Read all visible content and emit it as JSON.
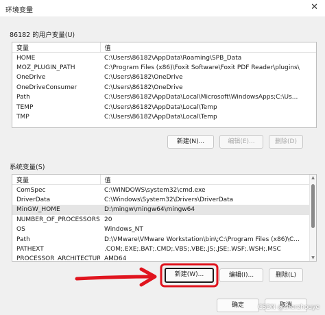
{
  "window": {
    "title": "环境变量",
    "close_icon": "close-icon"
  },
  "user_section": {
    "label": "86182 的用户变量(U)",
    "headers": [
      "变量",
      "值"
    ],
    "rows": [
      [
        "HOME",
        "C:\\Users\\86182\\AppData\\Roaming\\SPB_Data"
      ],
      [
        "MOZ_PLUGIN_PATH",
        "C:\\Program Files (x86)\\Foxit Software\\Foxit PDF Reader\\plugins\\"
      ],
      [
        "OneDrive",
        "C:\\Users\\86182\\OneDrive"
      ],
      [
        "OneDriveConsumer",
        "C:\\Users\\86182\\OneDrive"
      ],
      [
        "Path",
        "C:\\Users\\86182\\AppData\\Local\\Microsoft\\WindowsApps;C:\\Us..."
      ],
      [
        "TEMP",
        "C:\\Users\\86182\\AppData\\Local\\Temp"
      ],
      [
        "TMP",
        "C:\\Users\\86182\\AppData\\Local\\Temp"
      ]
    ],
    "buttons": {
      "new": "新建(N)...",
      "edit": "编辑(E)...",
      "delete": "删除(D)"
    }
  },
  "system_section": {
    "label": "系统变量(S)",
    "headers": [
      "变量",
      "值"
    ],
    "rows": [
      [
        "ComSpec",
        "C:\\WINDOWS\\system32\\cmd.exe"
      ],
      [
        "DriverData",
        "C:\\Windows\\System32\\Drivers\\DriverData"
      ],
      [
        "MinGW_HOME",
        "D:\\mingw\\mingw64\\mingw64"
      ],
      [
        "NUMBER_OF_PROCESSORS",
        "20"
      ],
      [
        "OS",
        "Windows_NT"
      ],
      [
        "Path",
        "D:\\VMware\\VMware Workstation\\bin\\;C:\\Program Files (x86)\\C..."
      ],
      [
        "PATHEXT",
        ".COM;.EXE;.BAT;.CMD;.VBS;.VBE;.JS;.JSE;.WSF;.WSH;.MSC"
      ],
      [
        "PROCESSOR_ARCHITECTURE",
        "AMD64"
      ]
    ],
    "selected_row": 2,
    "buttons": {
      "new": "新建(W)...",
      "edit": "编辑(I)...",
      "delete": "删除(L)"
    }
  },
  "footer": {
    "ok": "确定",
    "cancel": "取消"
  },
  "watermark": "CSDN @sherzhouye",
  "annotation_color": "#e0141e"
}
